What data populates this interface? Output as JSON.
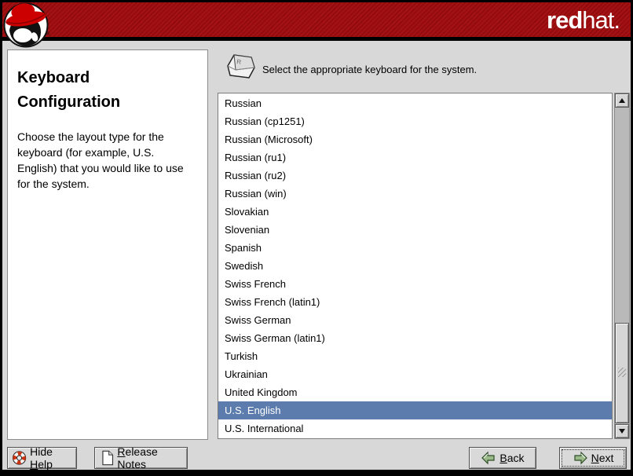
{
  "banner": {
    "brand_bold": "red",
    "brand_light": "hat."
  },
  "help_panel": {
    "title": "Keyboard Configuration",
    "body": "Choose the layout type for the keyboard (for example, U.S. English) that you would like to use for the system."
  },
  "header": {
    "instruction": "Select the appropriate keyboard for the system."
  },
  "list": {
    "items": [
      "Russian",
      "Russian (cp1251)",
      "Russian (Microsoft)",
      "Russian (ru1)",
      "Russian (ru2)",
      "Russian (win)",
      "Slovakian",
      "Slovenian",
      "Spanish",
      "Swedish",
      "Swiss French",
      "Swiss French (latin1)",
      "Swiss German",
      "Swiss German (latin1)",
      "Turkish",
      "Ukrainian",
      "United Kingdom",
      "U.S. English",
      "U.S. International"
    ],
    "selected_value": "U.S. English",
    "selected_index": 17
  },
  "buttons": {
    "hide_help": {
      "pre": "Hide ",
      "mnemonic": "H",
      "post": "elp"
    },
    "release_notes": {
      "pre": "",
      "mnemonic": "R",
      "post": "elease Notes"
    },
    "back": {
      "pre": "",
      "mnemonic": "B",
      "post": "ack"
    },
    "next": {
      "pre": "",
      "mnemonic": "N",
      "post": "ext"
    }
  },
  "colors": {
    "banner_red": "#a30d10",
    "selection_blue": "#5b7cac",
    "background_gray": "#d8d8d8",
    "hat_red": "#cc0000"
  }
}
